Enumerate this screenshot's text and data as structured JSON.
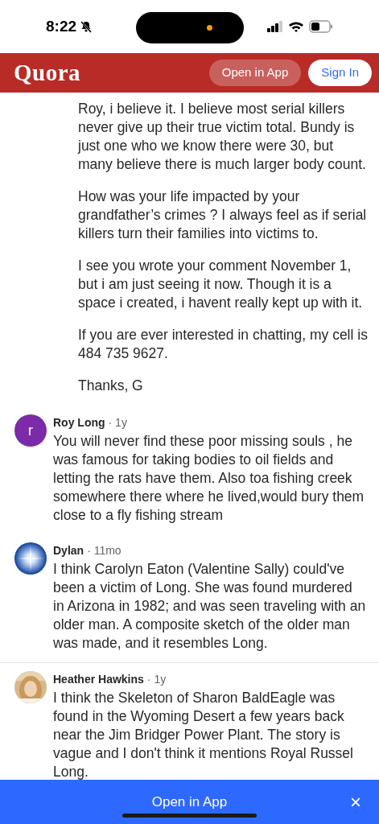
{
  "status_bar": {
    "time": "8:22"
  },
  "header": {
    "logo": "Quora",
    "open_button": "Open in App",
    "sign_in_button": "Sign In"
  },
  "reply": {
    "paragraphs": [
      "Roy, i believe it. I believe most serial killers never give up their true victim total. Bundy is just one who we know there were 30, but many believe there is much larger body count.",
      "How was your life impacted by your grandfather’s crimes ? I always feel as if serial killers turn their families into victims to.",
      "I see you wrote your comment November 1, but i am just seeing it now. Though it is a space i created, i havent really kept up with it.",
      "If you are ever interested in chatting, my cell is 484 735 9627.",
      "Thanks, G"
    ]
  },
  "comments": [
    {
      "kind": "letter",
      "avatar_letter": "r",
      "color": "#7b2aa8",
      "author": "Roy Long",
      "time": "· 1y",
      "text": "You will never find these poor missing souls , he was famous for taking bodies to oil fields and letting the rats have them. Also toa fishing creek somewhere there where he lived,would bury them close to a fly fishing stream",
      "divider": false
    },
    {
      "kind": "burst",
      "author": "Dylan",
      "time": "· 11mo",
      "text": "I think Carolyn Eaton (Valentine Sally) could've been a victim of Long. She was found murdered in Arizona in 1982; and was seen traveling with an older man. A composite sketch of the older man was made, and it resembles Long.",
      "divider": true
    },
    {
      "author": "Heather Hawkins",
      "time": "· 1y",
      "text": "I think the Skeleton of Sharon BaldEagle was found in the Wyoming Desert a few years back near the Jim Bridger Power Plant. The story is vague and I don't think it mentions Royal Russel Long.",
      "divider": false
    }
  ],
  "banner": {
    "label": "Open in App",
    "close": "×"
  }
}
